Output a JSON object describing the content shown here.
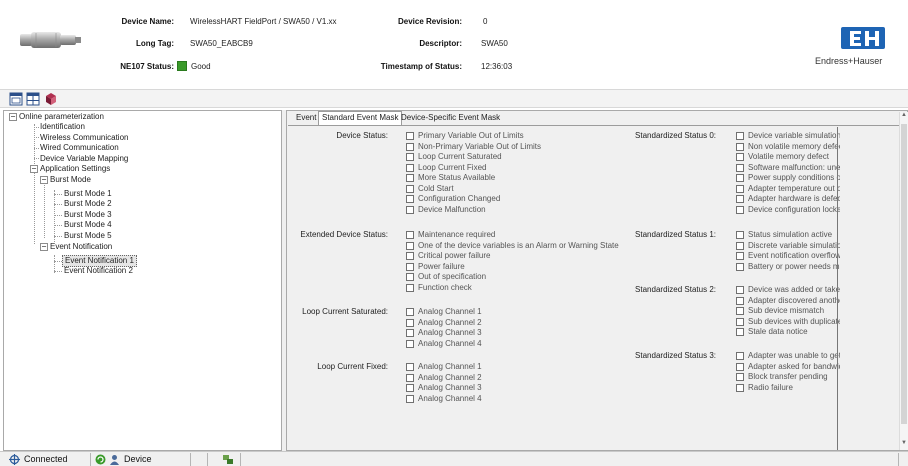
{
  "header": {
    "device_name_label": "Device Name:",
    "device_name": "WirelessHART FieldPort / SWA50 / V1.xx",
    "long_tag_label": "Long Tag:",
    "long_tag": "SWA50_EABCB9",
    "ne107_label": "NE107 Status:",
    "ne107_value": "Good",
    "ne107_color": "#3a9a2a",
    "revision_label": "Device Revision:",
    "revision": "0",
    "descriptor_label": "Descriptor:",
    "descriptor": "SWA50",
    "timestamp_label": "Timestamp of Status:",
    "timestamp": "12:36:03",
    "brand": "Endress+Hauser",
    "brand_color": "#1e64b4"
  },
  "toolbar": {
    "buttons": [
      "window-layout-icon",
      "grid-layout-icon",
      "book-help-icon"
    ]
  },
  "tree": {
    "root": "Online parameterization",
    "identification": "Identification",
    "wireless": "Wireless Communication",
    "wired": "Wired Communication",
    "mapping": "Device Variable Mapping",
    "app_settings": "Application Settings",
    "burst_mode": "Burst Mode",
    "burst": [
      "Burst Mode 1",
      "Burst Mode 2",
      "Burst Mode 3",
      "Burst Mode 4",
      "Burst Mode 5"
    ],
    "event_notification": "Event Notification",
    "events": [
      "Event Notification 1",
      "Event Notification 2"
    ],
    "selected": "Event Notification 1"
  },
  "tabs": {
    "event": "Event",
    "standard": "Standard Event Mask",
    "device_specific": "Device-Specific Event Mask",
    "active": "Standard Event Mask"
  },
  "groups": {
    "device_status": {
      "label": "Device Status:",
      "items": [
        "Primary Variable Out of Limits",
        "Non-Primary Variable Out of Limits",
        "Loop Current Saturated",
        "Loop Current Fixed",
        "More Status Available",
        "Cold Start",
        "Configuration Changed",
        "Device Malfunction"
      ]
    },
    "extended_device_status": {
      "label": "Extended Device Status:",
      "items": [
        "Maintenance required",
        "One of the device variables is an Alarm or Warning State",
        "Critical power failure",
        "Power failure",
        "Out of specification",
        "Function check"
      ]
    },
    "loop_current_saturated": {
      "label": "Loop Current Saturated:",
      "items": [
        "Analog Channel 1",
        "Analog Channel 2",
        "Analog Channel 3",
        "Analog Channel 4"
      ]
    },
    "loop_current_fixed": {
      "label": "Loop Current Fixed:",
      "items": [
        "Analog Channel 1",
        "Analog Channel 2",
        "Analog Channel 3",
        "Analog Channel 4"
      ]
    },
    "std_status_0": {
      "label": "Standardized Status 0:",
      "items": [
        "Device variable simulation a",
        "Non volatile memory defect",
        "Volatile memory defect",
        "Software malfunction: unex",
        "Power supply conditions ou",
        "Adapter temperature out o",
        "Adapter hardware is defect",
        "Device configuration locked"
      ]
    },
    "std_status_1": {
      "label": "Standardized Status 1:",
      "items": [
        "Status simulation active",
        "Discrete variable simulation",
        "Event notification overflow",
        "Battery or power needs ma"
      ]
    },
    "std_status_2": {
      "label": "Standardized Status 2:",
      "items": [
        "Device was added or taken",
        "Adapter discovered anothe",
        "Sub device mismatch",
        "Sub devices with duplicate",
        "Stale data notice"
      ]
    },
    "std_status_3": {
      "label": "Standardized Status 3:",
      "items": [
        "Adapter was unable to get",
        "Adapter asked for bandwid",
        "Block transfer pending",
        "Radio failure"
      ]
    }
  },
  "statusbar": {
    "connection": "Connected",
    "mode": "Device"
  }
}
